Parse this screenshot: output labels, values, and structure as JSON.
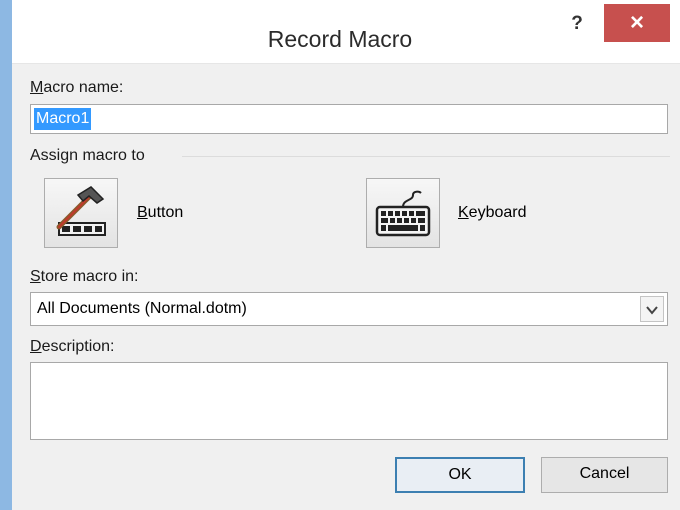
{
  "window": {
    "title": "Record Macro",
    "help_glyph": "?",
    "close_glyph": "×"
  },
  "macro_name": {
    "label_prefix": "",
    "label_access": "M",
    "label_rest": "acro name:",
    "value": "Macro1"
  },
  "assign": {
    "label": "Assign macro to",
    "button": {
      "access": "B",
      "rest": "utton"
    },
    "keyboard": {
      "access": "K",
      "rest": "eyboard"
    }
  },
  "store": {
    "label_access": "S",
    "label_rest": "tore macro in:",
    "selected": "All Documents (Normal.dotm)"
  },
  "description": {
    "label_access": "D",
    "label_rest": "escription:",
    "value": ""
  },
  "buttons": {
    "ok": "OK",
    "cancel": "Cancel"
  },
  "icons": {
    "button": "hammer-toolbar-icon",
    "keyboard": "keyboard-icon",
    "dropdown": "chevron-down-icon"
  },
  "colors": {
    "close_button": "#c7504e",
    "selection": "#3399ff",
    "ok_border": "#3c7fb1"
  }
}
